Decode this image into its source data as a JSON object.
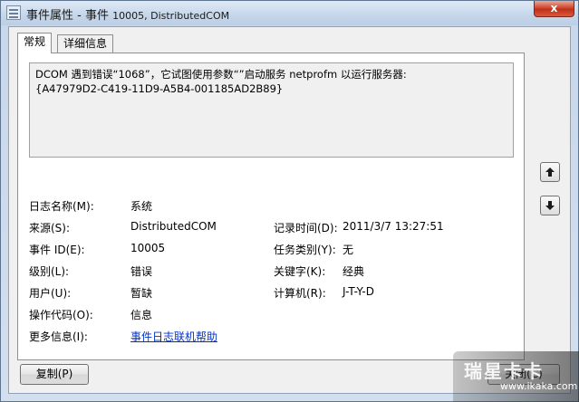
{
  "window": {
    "title_main": "事件属性 - 事件",
    "title_sub": "10005, DistributedCOM",
    "close_label": "x"
  },
  "tabs": [
    {
      "label": "常规",
      "active": true
    },
    {
      "label": "详细信息",
      "active": false
    }
  ],
  "description": "DCOM 遇到错误“1068”，它试图使用参数“”启动服务 netprofm 以运行服务器:\n{A47979D2-C419-11D9-A5B4-001185AD2B89}",
  "fields": {
    "log_name_label": "日志名称(M):",
    "log_name_value": "系统",
    "source_label": "来源(S):",
    "source_value": "DistributedCOM",
    "logged_label": "记录时间(D):",
    "logged_value": "2011/3/7 13:27:51",
    "event_id_label": "事件 ID(E):",
    "event_id_value": "10005",
    "task_category_label": "任务类别(Y):",
    "task_category_value": "无",
    "level_label": "级别(L):",
    "level_value": "错误",
    "keywords_label": "关键字(K):",
    "keywords_value": "经典",
    "user_label": "用户(U):",
    "user_value": "暂缺",
    "computer_label": "计算机(R):",
    "computer_value": "J-T-Y-D",
    "opcode_label": "操作代码(O):",
    "opcode_value": "信息",
    "more_info_label": "更多信息(I):",
    "more_info_link": "事件日志联机帮助"
  },
  "buttons": {
    "copy": "复制(P)",
    "close": "关闭(C)"
  },
  "watermark": {
    "title": "瑞星卡卡",
    "url": "www.ikaka.com"
  }
}
